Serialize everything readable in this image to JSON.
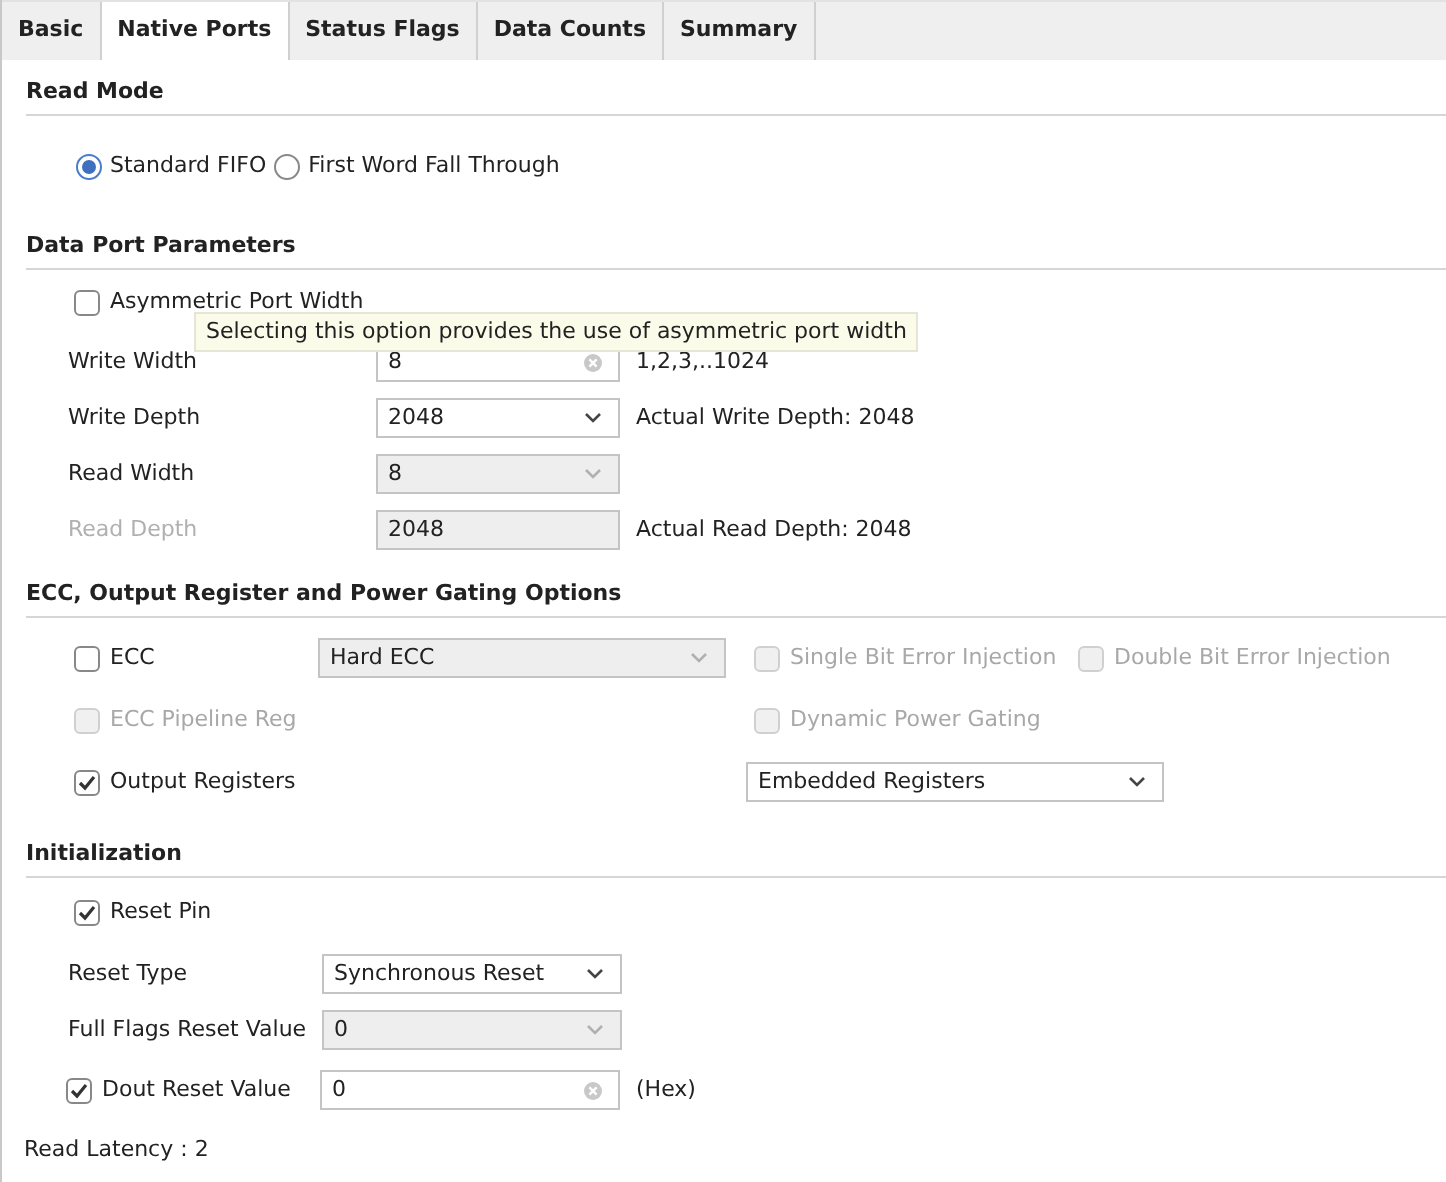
{
  "tabs": [
    {
      "label": "Basic",
      "selected": false
    },
    {
      "label": "Native Ports",
      "selected": true
    },
    {
      "label": "Status Flags",
      "selected": false
    },
    {
      "label": "Data Counts",
      "selected": false
    },
    {
      "label": "Summary",
      "selected": false
    }
  ],
  "read_mode": {
    "title": "Read Mode",
    "options": [
      {
        "label": "Standard FIFO",
        "selected": true
      },
      {
        "label": "First Word Fall Through",
        "selected": false
      }
    ]
  },
  "data_port_parameters": {
    "title": "Data Port Parameters",
    "asymmetric": {
      "label": "Asymmetric Port Width",
      "checked": false
    },
    "tooltip": "Selecting this option provides the use of asymmetric port width",
    "rows": [
      {
        "kind": "text",
        "label": "Write Width",
        "value": "8",
        "disabled": false,
        "note": "1,2,3,..1024"
      },
      {
        "kind": "select",
        "label": "Write Depth",
        "value": "2048",
        "disabled": false,
        "note": "Actual Write Depth: 2048"
      },
      {
        "kind": "select",
        "label": "Read Width",
        "value": "8",
        "disabled": true
      },
      {
        "kind": "readonly",
        "label": "Read Depth",
        "value": "2048",
        "disabled": true,
        "note": "Actual Read Depth: 2048"
      }
    ]
  },
  "ecc_options": {
    "title": "ECC, Output Register and Power Gating Options",
    "ecc": {
      "label": "ECC",
      "checked": false,
      "disabled": false
    },
    "ecc_type": {
      "value": "Hard ECC",
      "disabled": true
    },
    "single_bit_error_injection": {
      "label": "Single Bit Error Injection",
      "checked": false,
      "disabled": true
    },
    "double_bit_error_injection": {
      "label": "Double Bit Error Injection",
      "checked": false,
      "disabled": true
    },
    "ecc_pipeline_reg": {
      "label": "ECC Pipeline Reg",
      "checked": false,
      "disabled": true
    },
    "dynamic_power_gating": {
      "label": "Dynamic Power Gating",
      "checked": false,
      "disabled": true
    },
    "output_registers": {
      "label": "Output Registers",
      "checked": true,
      "disabled": false
    },
    "output_register_type": {
      "value": "Embedded Registers",
      "disabled": false
    }
  },
  "initialization": {
    "title": "Initialization",
    "reset_pin": {
      "label": "Reset Pin",
      "checked": true,
      "disabled": false
    },
    "rows": [
      {
        "kind": "select",
        "label": "Reset Type",
        "value": "Synchronous Reset",
        "disabled": false
      },
      {
        "kind": "select",
        "label": "Full Flags Reset Value",
        "value": "0",
        "disabled": true
      },
      {
        "kind": "text",
        "label": "Dout Reset Value",
        "value": "0",
        "disabled": false,
        "checked": true,
        "note": "(Hex)"
      }
    ],
    "read_latency": "Read Latency : 2"
  }
}
